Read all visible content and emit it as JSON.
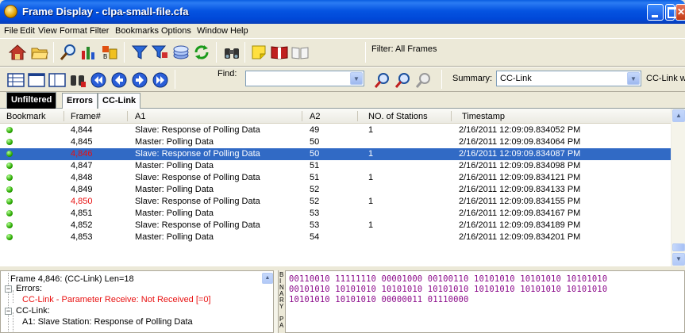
{
  "window": {
    "title": "Frame Display - clpa-small-file.cfa"
  },
  "menu": [
    "File",
    "Edit",
    "View",
    "Format",
    "Filter",
    "Bookmarks",
    "Options",
    "Window",
    "Help"
  ],
  "toolbar": {
    "filter_label": "Filter:  All Frames",
    "find_label": "Find:",
    "find_value": "",
    "summary_label": "Summary:",
    "summary_value": "CC-Link",
    "summary_extra": "CC-Link with Auto"
  },
  "tabs": [
    "Unfiltered",
    "Errors",
    "CC-Link"
  ],
  "table": {
    "columns": [
      "Bookmark",
      "Frame#",
      "A1",
      "A2",
      "NO. of Stations",
      "Timestamp"
    ],
    "rows": [
      {
        "frame": "4,844",
        "a1": "Slave: Response of Polling Data",
        "a2": "49",
        "stations": "1",
        "timestamp": "2/16/2011 12:09:09.834052 PM"
      },
      {
        "frame": "4,845",
        "a1": "Master: Polling Data",
        "a2": "50",
        "stations": "",
        "timestamp": "2/16/2011 12:09:09.834064 PM"
      },
      {
        "frame": "4,846",
        "a1": "Slave: Response of Polling Data",
        "a2": "50",
        "stations": "1",
        "timestamp": "2/16/2011 12:09:09.834087 PM"
      },
      {
        "frame": "4,847",
        "a1": "Master: Polling Data",
        "a2": "51",
        "stations": "",
        "timestamp": "2/16/2011 12:09:09.834098 PM"
      },
      {
        "frame": "4,848",
        "a1": "Slave: Response of Polling Data",
        "a2": "51",
        "stations": "1",
        "timestamp": "2/16/2011 12:09:09.834121 PM"
      },
      {
        "frame": "4,849",
        "a1": "Master: Polling Data",
        "a2": "52",
        "stations": "",
        "timestamp": "2/16/2011 12:09:09.834133 PM"
      },
      {
        "frame": "4,850",
        "a1": "Slave: Response of Polling Data",
        "a2": "52",
        "stations": "1",
        "timestamp": "2/16/2011 12:09:09.834155 PM"
      },
      {
        "frame": "4,851",
        "a1": "Master: Polling Data",
        "a2": "53",
        "stations": "",
        "timestamp": "2/16/2011 12:09:09.834167 PM"
      },
      {
        "frame": "4,852",
        "a1": "Slave: Response of Polling Data",
        "a2": "53",
        "stations": "1",
        "timestamp": "2/16/2011 12:09:09.834189 PM"
      },
      {
        "frame": "4,853",
        "a1": "Master: Polling Data",
        "a2": "54",
        "stations": "",
        "timestamp": "2/16/2011 12:09:09.834201 PM"
      }
    ],
    "selected_row": 2,
    "error_rows": [
      2,
      6
    ]
  },
  "tree": {
    "lines": [
      "Frame 4,846: (CC-Link) Len=18",
      "Errors:",
      "CC-Link - Parameter Receive: Not Received [=0]",
      "CC-Link:",
      "A1: Slave Station: Response of Polling Data"
    ]
  },
  "binary": {
    "side_letters": [
      "B",
      "I",
      "N",
      "A",
      "R",
      "Y",
      "",
      "P",
      "A"
    ],
    "lines": [
      "00110010 11111110 00001000 00100110 10101010 10101010 10101010",
      "00101010 10101010 10101010 10101010 10101010 10101010 10101010",
      "10101010 10101010 00000011 01110000"
    ]
  },
  "colors": {
    "selection": "#316ac5",
    "error_text": "#e81010",
    "binary_text": "#8b0a8a",
    "title_bar": "#0054e3"
  }
}
